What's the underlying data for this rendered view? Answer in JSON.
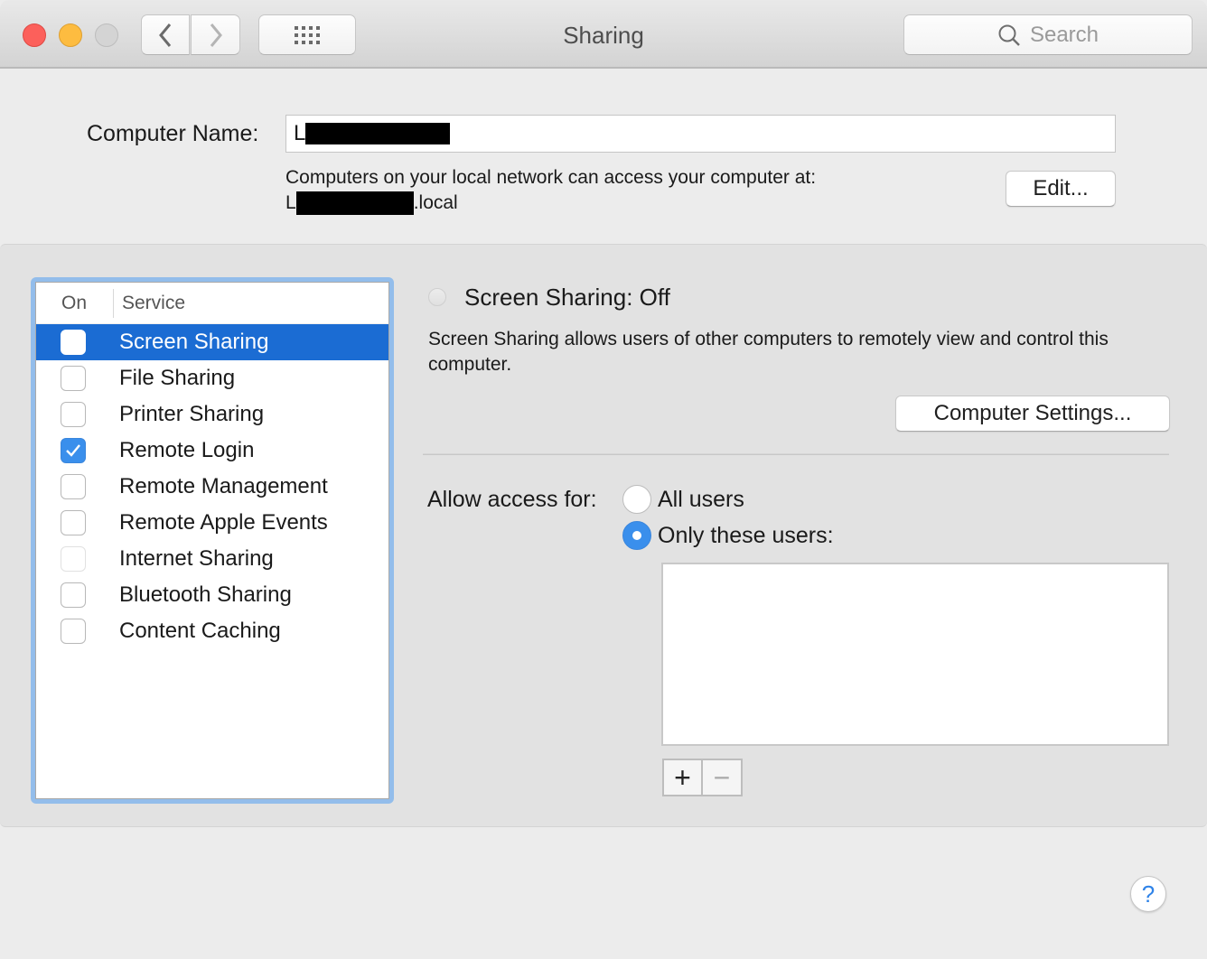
{
  "window": {
    "title": "Sharing",
    "search_placeholder": "Search",
    "nav_back_icon": "chevron-left",
    "nav_forward_icon": "chevron-right",
    "show_all_icon": "grid-dots"
  },
  "computer_name": {
    "label": "Computer Name:",
    "value_prefix": "L",
    "redacted": true,
    "help_text": "Computers on your local network can access your computer at:",
    "hostname_prefix": "L",
    "hostname_suffix": ".local",
    "edit_button": "Edit..."
  },
  "services": {
    "headers": {
      "on": "On",
      "service": "Service"
    },
    "items": [
      {
        "label": "Screen Sharing",
        "checked": false,
        "selected": true,
        "disabled": false
      },
      {
        "label": "File Sharing",
        "checked": false,
        "selected": false,
        "disabled": false
      },
      {
        "label": "Printer Sharing",
        "checked": false,
        "selected": false,
        "disabled": false
      },
      {
        "label": "Remote Login",
        "checked": true,
        "selected": false,
        "disabled": false
      },
      {
        "label": "Remote Management",
        "checked": false,
        "selected": false,
        "disabled": false
      },
      {
        "label": "Remote Apple Events",
        "checked": false,
        "selected": false,
        "disabled": false
      },
      {
        "label": "Internet Sharing",
        "checked": false,
        "selected": false,
        "disabled": true
      },
      {
        "label": "Bluetooth Sharing",
        "checked": false,
        "selected": false,
        "disabled": false
      },
      {
        "label": "Content Caching",
        "checked": false,
        "selected": false,
        "disabled": false
      }
    ]
  },
  "detail": {
    "status_title": "Screen Sharing: Off",
    "description": "Screen Sharing allows users of other computers to remotely view and control this computer.",
    "computer_settings_button": "Computer Settings...",
    "allow_access_label": "Allow access for:",
    "options": [
      {
        "label": "All users",
        "selected": false
      },
      {
        "label": "Only these users:",
        "selected": true
      }
    ],
    "users": [],
    "add_button": "+",
    "remove_button": "−"
  },
  "help_button": "?",
  "colors": {
    "selection": "#1b6cd3",
    "checkbox_checked": "#3a8fec",
    "focus_ring": "#93bdeb",
    "help_glyph": "#2f83e8"
  }
}
